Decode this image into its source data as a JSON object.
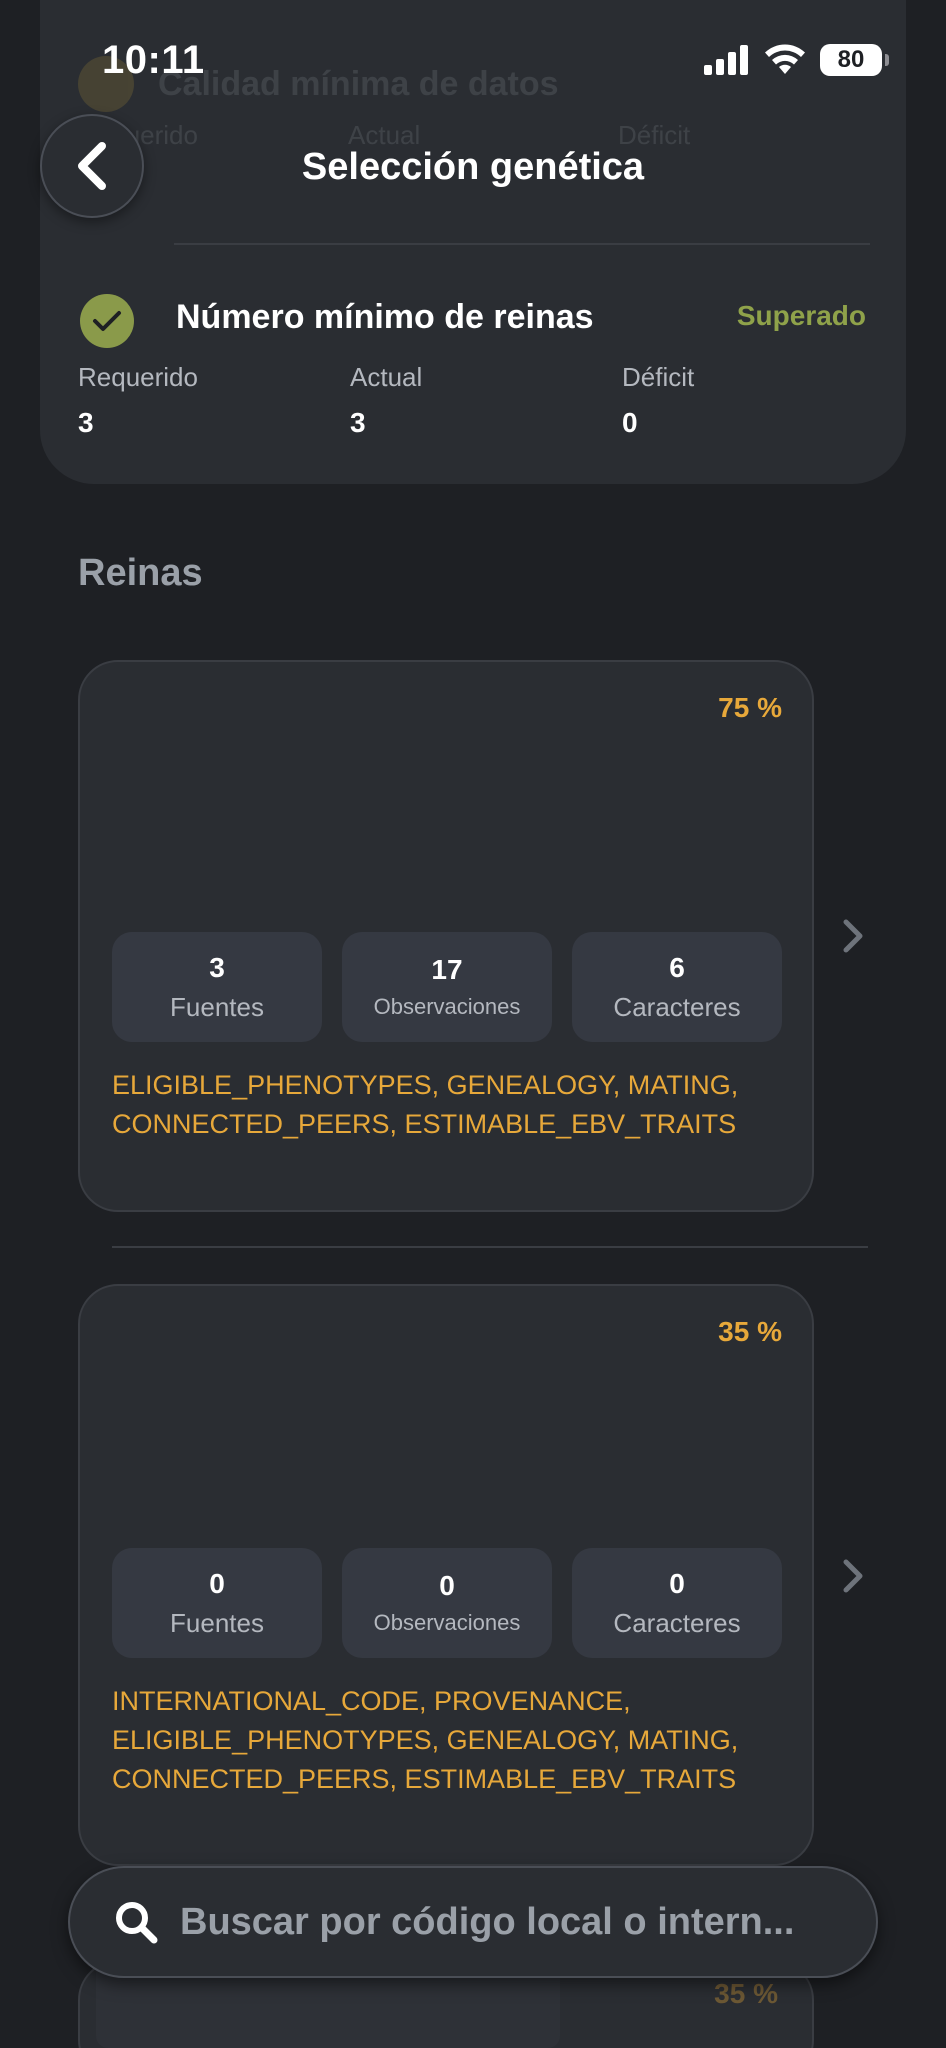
{
  "status_bar": {
    "time": "10:11",
    "battery": "80"
  },
  "header": {
    "title": "Selección genética",
    "faded_title": "Calidad mínima de datos",
    "faded_cols": [
      "Requerido",
      "Actual",
      "Déficit"
    ]
  },
  "requirement": {
    "title": "Número mínimo de reinas",
    "status": "Superado",
    "columns": [
      {
        "label": "Requerido",
        "value": "3"
      },
      {
        "label": "Actual",
        "value": "3"
      },
      {
        "label": "Déficit",
        "value": "0"
      }
    ]
  },
  "section": {
    "title": "Reinas"
  },
  "queens": [
    {
      "percent": "75 %",
      "stats": [
        {
          "value": "3",
          "label": "Fuentes"
        },
        {
          "value": "17",
          "label": "Observaciones"
        },
        {
          "value": "6",
          "label": "Caracteres"
        }
      ],
      "tags": "ELIGIBLE_PHENOTYPES, GENEALOGY, MATING, CONNECTED_PEERS, ESTIMABLE_EBV_TRAITS"
    },
    {
      "percent": "35 %",
      "stats": [
        {
          "value": "0",
          "label": "Fuentes"
        },
        {
          "value": "0",
          "label": "Observaciones"
        },
        {
          "value": "0",
          "label": "Caracteres"
        }
      ],
      "tags": "INTERNATIONAL_CODE, PROVENANCE, ELIGIBLE_PHENOTYPES, GENEALOGY, MATING, CONNECTED_PEERS, ESTIMABLE_EBV_TRAITS"
    },
    {
      "percent": "35 %"
    }
  ],
  "search": {
    "placeholder": "Buscar por código local o intern..."
  },
  "colors": {
    "accent": "#e7a83a",
    "success": "#8fa24a",
    "background": "#1e2024",
    "card": "#2a2d32"
  }
}
